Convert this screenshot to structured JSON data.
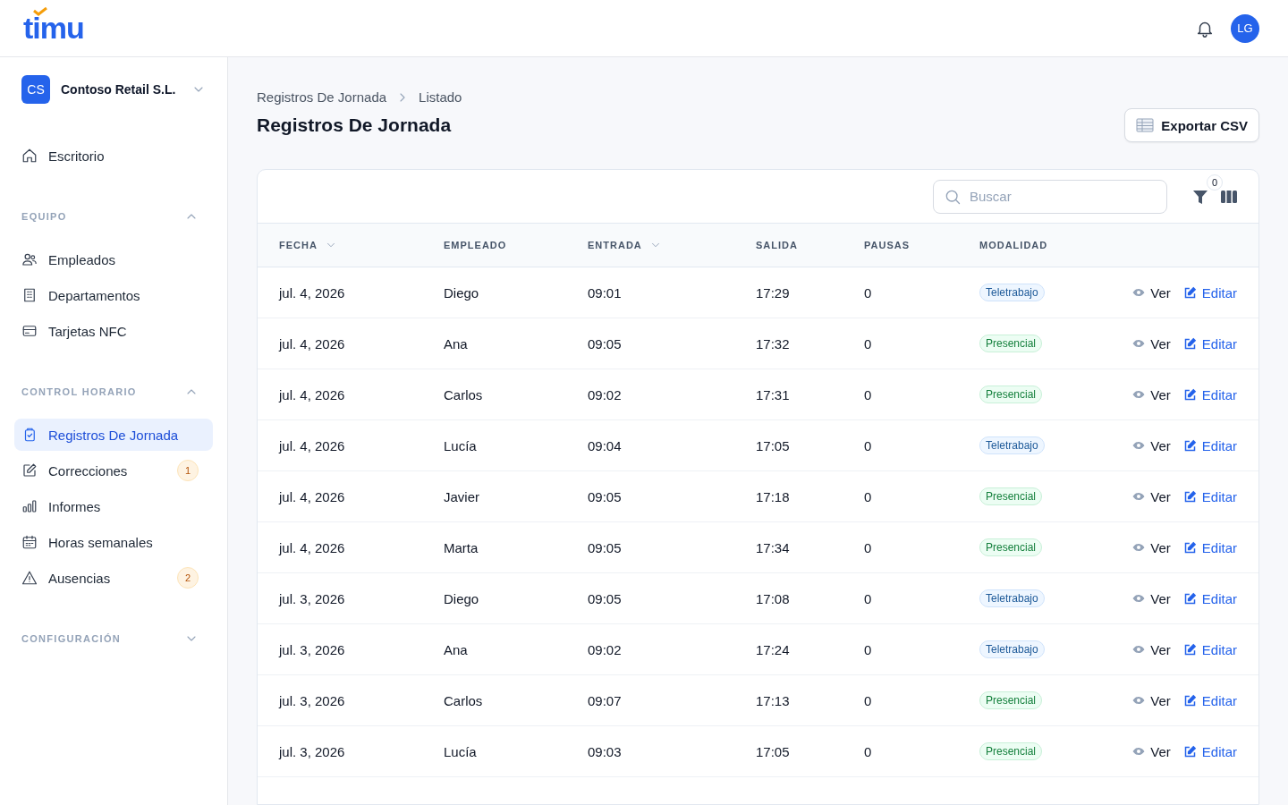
{
  "header": {
    "logo": "timu",
    "avatar": "LG"
  },
  "sidebar": {
    "org": {
      "initials": "CS",
      "name": "Contoso Retail S.L."
    },
    "top_items": [
      {
        "label": "Escritorio",
        "selected": false
      }
    ],
    "sections": [
      {
        "title": "EQUIPO",
        "expanded": true,
        "items": [
          {
            "label": "Empleados",
            "selected": false
          },
          {
            "label": "Departamentos",
            "selected": false
          },
          {
            "label": "Tarjetas NFC",
            "selected": false
          }
        ]
      },
      {
        "title": "CONTROL HORARIO",
        "expanded": true,
        "items": [
          {
            "label": "Registros De Jornada",
            "selected": true
          },
          {
            "label": "Correcciones",
            "selected": false,
            "badge": "1"
          },
          {
            "label": "Informes",
            "selected": false
          },
          {
            "label": "Horas semanales",
            "selected": false
          },
          {
            "label": "Ausencias",
            "selected": false,
            "badge": "2"
          }
        ]
      },
      {
        "title": "CONFIGURACIÓN",
        "expanded": false
      }
    ]
  },
  "breadcrumb": [
    "Registros De Jornada",
    "Listado"
  ],
  "page_title": "Registros De Jornada",
  "export_button": "Exportar CSV",
  "search": {
    "placeholder": "Buscar"
  },
  "filter_count": "0",
  "table": {
    "columns": [
      {
        "label": "FECHA",
        "sortable": true
      },
      {
        "label": "EMPLEADO",
        "sortable": false
      },
      {
        "label": "ENTRADA",
        "sortable": true
      },
      {
        "label": "SALIDA",
        "sortable": false
      },
      {
        "label": "PAUSAS",
        "sortable": false
      },
      {
        "label": "MODALIDAD",
        "sortable": false
      }
    ],
    "rows": [
      {
        "fecha": "jul. 4, 2026",
        "empleado": "Diego",
        "entrada": "09:01",
        "salida": "17:29",
        "pausas": "0",
        "modalidad": {
          "label": "Teletrabajo",
          "kind": "remote"
        },
        "view": "Ver",
        "edit": "Editar"
      },
      {
        "fecha": "jul. 4, 2026",
        "empleado": "Ana",
        "entrada": "09:05",
        "salida": "17:32",
        "pausas": "0",
        "modalidad": {
          "label": "Presencial",
          "kind": "onsite"
        },
        "view": "Ver",
        "edit": "Editar"
      },
      {
        "fecha": "jul. 4, 2026",
        "empleado": "Carlos",
        "entrada": "09:02",
        "salida": "17:31",
        "pausas": "0",
        "modalidad": {
          "label": "Presencial",
          "kind": "onsite"
        },
        "view": "Ver",
        "edit": "Editar"
      },
      {
        "fecha": "jul. 4, 2026",
        "empleado": "Lucía",
        "entrada": "09:04",
        "salida": "17:05",
        "pausas": "0",
        "modalidad": {
          "label": "Teletrabajo",
          "kind": "remote"
        },
        "view": "Ver",
        "edit": "Editar"
      },
      {
        "fecha": "jul. 4, 2026",
        "empleado": "Javier",
        "entrada": "09:05",
        "salida": "17:18",
        "pausas": "0",
        "modalidad": {
          "label": "Presencial",
          "kind": "onsite"
        },
        "view": "Ver",
        "edit": "Editar"
      },
      {
        "fecha": "jul. 4, 2026",
        "empleado": "Marta",
        "entrada": "09:05",
        "salida": "17:34",
        "pausas": "0",
        "modalidad": {
          "label": "Presencial",
          "kind": "onsite"
        },
        "view": "Ver",
        "edit": "Editar"
      },
      {
        "fecha": "jul. 3, 2026",
        "empleado": "Diego",
        "entrada": "09:05",
        "salida": "17:08",
        "pausas": "0",
        "modalidad": {
          "label": "Teletrabajo",
          "kind": "remote"
        },
        "view": "Ver",
        "edit": "Editar"
      },
      {
        "fecha": "jul. 3, 2026",
        "empleado": "Ana",
        "entrada": "09:02",
        "salida": "17:24",
        "pausas": "0",
        "modalidad": {
          "label": "Teletrabajo",
          "kind": "remote"
        },
        "view": "Ver",
        "edit": "Editar"
      },
      {
        "fecha": "jul. 3, 2026",
        "empleado": "Carlos",
        "entrada": "09:07",
        "salida": "17:13",
        "pausas": "0",
        "modalidad": {
          "label": "Presencial",
          "kind": "onsite"
        },
        "view": "Ver",
        "edit": "Editar"
      },
      {
        "fecha": "jul. 3, 2026",
        "empleado": "Lucía",
        "entrada": "09:03",
        "salida": "17:05",
        "pausas": "0",
        "modalidad": {
          "label": "Presencial",
          "kind": "onsite"
        },
        "view": "Ver",
        "edit": "Editar"
      }
    ]
  }
}
